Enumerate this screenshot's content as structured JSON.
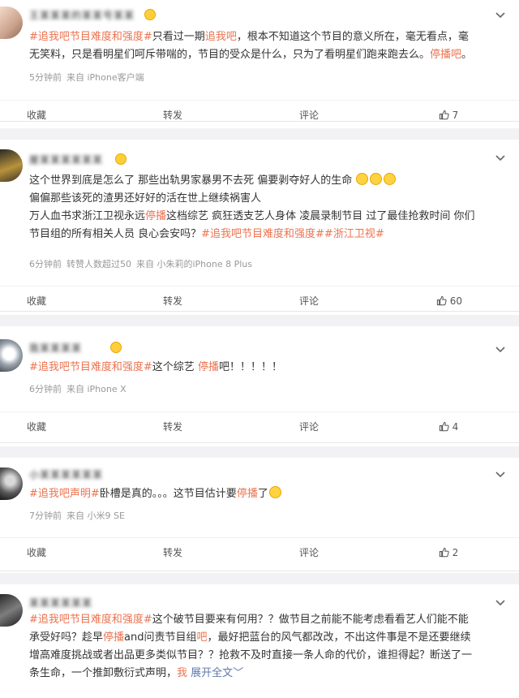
{
  "icons": {
    "like": "thumbs-up-icon",
    "more": "chevron-down-icon",
    "emoji": "emoji-icon"
  },
  "colors": {
    "tag": "#eb7350",
    "link": "#5d79a8",
    "meta": "#999999",
    "separator": "#f2f2f5"
  },
  "actions": {
    "collect": "收藏",
    "repost": "转发",
    "comment": "评论"
  },
  "posts": [
    {
      "username": "王某某某的某某号某某",
      "lines": [
        [
          "#追我吧节目难度和强度#",
          "只看过一期",
          "追我吧",
          "，根本不知道这个节目的意义所在，毫无看点，毫"
        ],
        [
          "无笑料，只是看明星们呵斥带喘的，节目的受众是什么，只为了看明星们跑来跑去么。",
          "停播吧",
          "。"
        ]
      ],
      "meta": [
        "5分钟前",
        "来自 iPhone客户端"
      ],
      "likes": "7"
    },
    {
      "username": "屋某某某某某某",
      "lines": [
        [
          "这个世界到底是怎么了 那些出轨男家暴男不去死 偏要剥夺好人的生命"
        ],
        [
          "偏偏那些该死的渣男还好好的活在世上继续祸害人"
        ],
        [
          "万人血书求浙江卫视永远",
          "停播",
          "这档综艺 疯狂透支艺人身体 凌晨录制节目 过了最佳抢救时间 你们"
        ],
        [
          "节目组的所有相关人员 良心会安吗？",
          "#追我吧节目难度和强度##浙江卫视#"
        ]
      ],
      "meta": [
        "6分钟前",
        "转赞人数超过50",
        "来自 小朱莉的iPhone 8 Plus"
      ],
      "likes": "60"
    },
    {
      "username": "我某某某某",
      "lines": [
        [
          "#追我吧节目难度和强度#",
          "这个综艺 ",
          "停播",
          "吧！！！！！"
        ]
      ],
      "meta": [
        "6分钟前",
        "来自 iPhone X"
      ],
      "likes": "4"
    },
    {
      "username": "小某某某某某某",
      "lines": [
        [
          "#追我吧声明#",
          "卧槽是真的。。。这节目估计要",
          "停播",
          "了"
        ]
      ],
      "meta": [
        "7分钟前",
        "来自 小米9 SE"
      ],
      "likes": "2"
    },
    {
      "username": "某某某某某某",
      "lines": [
        [
          "#追我吧节目难度和强度#",
          "这个破节目要来有何用？？做节目之前能不能考虑看看艺人们能不能"
        ],
        [
          "承受好吗？趁早",
          "停播",
          "and问责节目组",
          "吧",
          "，最好把蓝台的风气都改改，不出这件事是不是还要继续"
        ],
        [
          "增高难度挑战或者出品更多类似节目？？抢救不及时直接一条人命的代价，谁担得起？断送了一"
        ],
        [
          "条生命，一个推卸敷衍式声明，",
          "我",
          " ",
          "展开全文",
          "﹀"
        ]
      ]
    }
  ]
}
